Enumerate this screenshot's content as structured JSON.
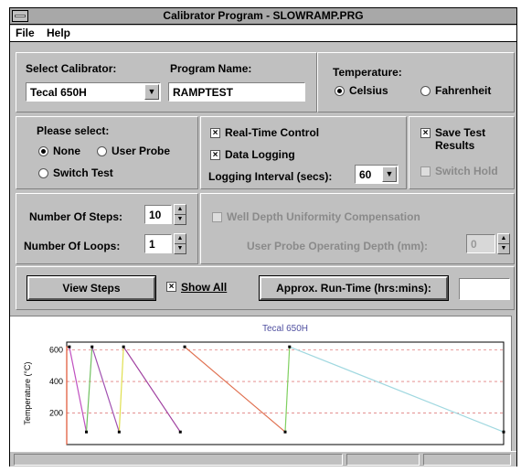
{
  "window": {
    "title": "Calibrator Program - SLOWRAMP.PRG"
  },
  "menu": {
    "file": "File",
    "help": "Help"
  },
  "calibrator": {
    "label": "Select Calibrator:",
    "value": "Tecal 650H"
  },
  "program": {
    "label": "Program Name:",
    "value": "RAMPTEST"
  },
  "temperature": {
    "label": "Temperature:",
    "celsius": "Celsius",
    "fahrenheit": "Fahrenheit",
    "selected": "celsius"
  },
  "select": {
    "label": "Please select:",
    "none": "None",
    "user_probe": "User Probe",
    "switch_test": "Switch Test",
    "selected": "none"
  },
  "control": {
    "realtime": "Real-Time Control",
    "realtime_checked": true,
    "logging": "Data Logging",
    "logging_checked": true,
    "interval_label": "Logging Interval (secs):",
    "interval_value": "60"
  },
  "save": {
    "save_results": "Save Test Results",
    "save_checked": true,
    "switch_hold": "Switch Hold",
    "switch_hold_checked": false
  },
  "steps": {
    "steps_label": "Number Of Steps:",
    "steps_value": "10",
    "loops_label": "Number Of Loops:",
    "loops_value": "1"
  },
  "well": {
    "label": "Well Depth Uniformity Compensation",
    "depth_label": "User Probe Operating Depth (mm):",
    "depth_value": "0"
  },
  "actions": {
    "view_steps": "View Steps",
    "show_all": "Show All",
    "show_all_checked": true,
    "runtime_label": "Approx. Run-Time (hrs:mins):",
    "runtime_value": ""
  },
  "chart_data": {
    "type": "line",
    "title": "Tecal 650H",
    "ylabel": "Temperature (°C)",
    "yticks": [
      200,
      400,
      600
    ],
    "ylim": [
      0,
      650
    ],
    "xlim": [
      0,
      100
    ],
    "series": [
      {
        "color": "#e05030",
        "values": [
          [
            0,
            0
          ],
          [
            0,
            620
          ],
          [
            0.6,
            620
          ]
        ]
      },
      {
        "color": "#c050c0",
        "values": [
          [
            0.6,
            620
          ],
          [
            4.5,
            80
          ]
        ]
      },
      {
        "color": "#70c060",
        "values": [
          [
            4.5,
            80
          ],
          [
            5.8,
            620
          ]
        ]
      },
      {
        "color": "#a050b0",
        "values": [
          [
            5.8,
            620
          ],
          [
            12,
            80
          ]
        ]
      },
      {
        "color": "#e0e050",
        "values": [
          [
            12,
            80
          ],
          [
            13,
            620
          ]
        ]
      },
      {
        "color": "#a040a0",
        "values": [
          [
            13,
            620
          ],
          [
            26,
            80
          ]
        ]
      },
      {
        "color": "#e07050",
        "values": [
          [
            27,
            620
          ],
          [
            50,
            80
          ]
        ]
      },
      {
        "color": "#80d060",
        "values": [
          [
            50,
            80
          ],
          [
            51,
            620
          ]
        ]
      },
      {
        "color": "#a0d8e0",
        "values": [
          [
            51,
            620
          ],
          [
            100,
            80
          ]
        ]
      }
    ],
    "markers": [
      [
        0.6,
        620
      ],
      [
        4.5,
        80
      ],
      [
        5.8,
        620
      ],
      [
        12,
        80
      ],
      [
        13,
        620
      ],
      [
        26,
        80
      ],
      [
        27,
        620
      ],
      [
        50,
        80
      ],
      [
        51,
        620
      ],
      [
        100,
        80
      ]
    ]
  }
}
